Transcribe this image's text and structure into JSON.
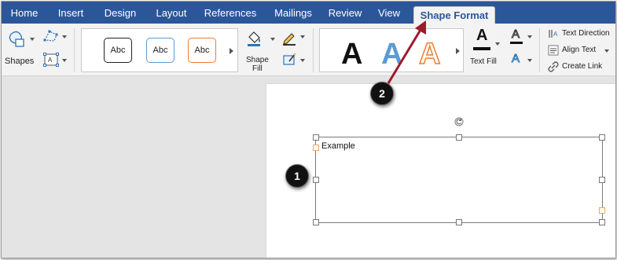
{
  "tabs": [
    {
      "label": "Home"
    },
    {
      "label": "Insert"
    },
    {
      "label": "Design"
    },
    {
      "label": "Layout"
    },
    {
      "label": "References"
    },
    {
      "label": "Mailings"
    },
    {
      "label": "Review"
    },
    {
      "label": "View"
    },
    {
      "label": "Shape Format"
    }
  ],
  "ribbon": {
    "shapes_label": "Shapes",
    "shape_styles": [
      {
        "label": "Abc",
        "border_color": "#222222"
      },
      {
        "label": "Abc",
        "border_color": "#5b9bd5"
      },
      {
        "label": "Abc",
        "border_color": "#ed7d31"
      }
    ],
    "shape_fill_label_line1": "Shape",
    "shape_fill_label_line2": "Fill",
    "wordart": [
      {
        "label": "A",
        "color": "#111111"
      },
      {
        "label": "A",
        "color": "#5b9bd5"
      },
      {
        "label": "A",
        "color": "#ed7d31"
      }
    ],
    "text_fill_label": "Text Fill",
    "text_fill_letter": "A",
    "text_outline_letter": "A",
    "text_effects_letter": "A",
    "text_direction_label": "Text Direction",
    "align_text_label": "Align Text",
    "create_link_label": "Create Link"
  },
  "document": {
    "textbox_text": "Example"
  },
  "callouts": [
    {
      "label": "1"
    },
    {
      "label": "2"
    }
  ],
  "colors": {
    "tab_bar": "#2b579a",
    "annotation_arrow": "#9e1b2a"
  }
}
